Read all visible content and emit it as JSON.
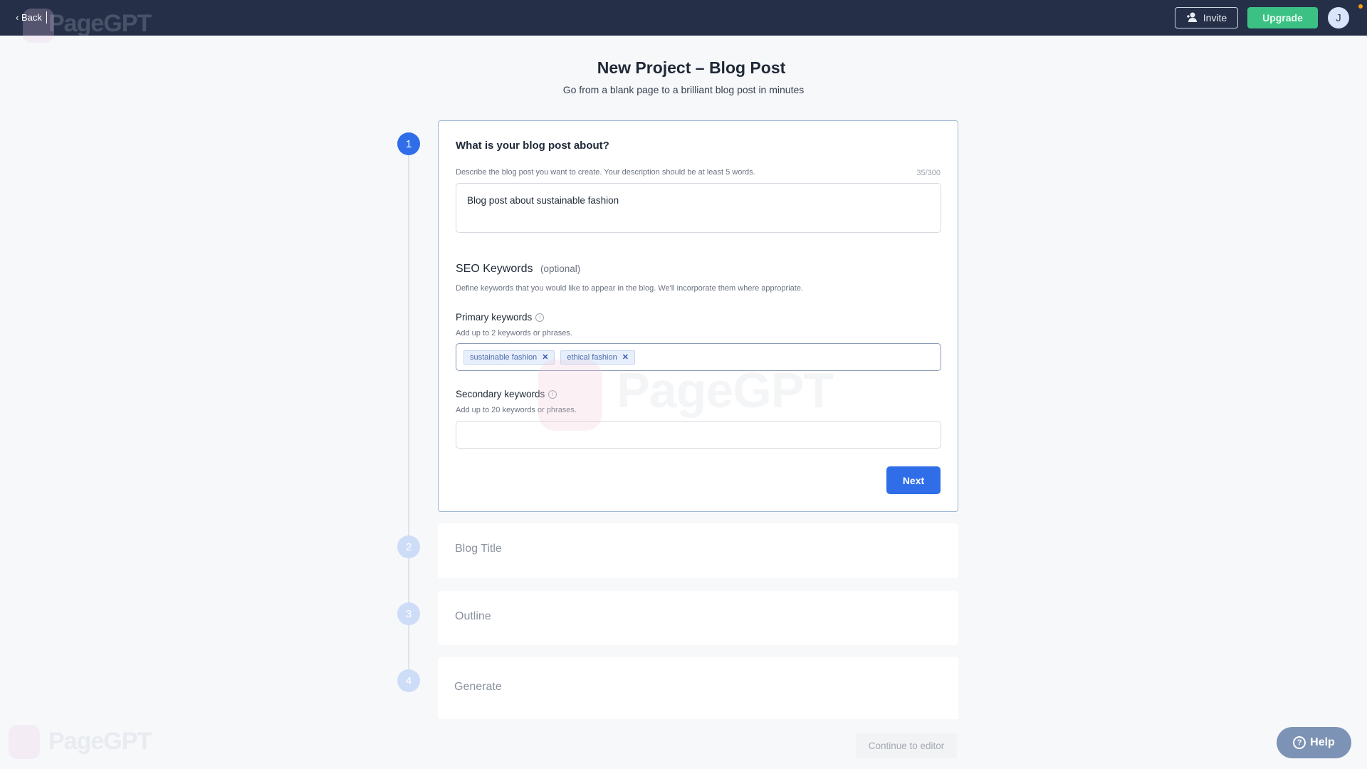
{
  "nav": {
    "back_label": "Back",
    "invite_label": "Invite",
    "upgrade_label": "Upgrade",
    "avatar_initial": "J",
    "watermark": "PageGPT"
  },
  "header": {
    "title": "New Project – Blog Post",
    "subtitle": "Go from a blank page to a brilliant blog post in minutes"
  },
  "steps": [
    {
      "number": "1",
      "label": "What is your blog post about?",
      "state": "active"
    },
    {
      "number": "2",
      "label": "Blog Title",
      "state": "inactive"
    },
    {
      "number": "3",
      "label": "Outline",
      "state": "inactive"
    },
    {
      "number": "4",
      "label": "Generate",
      "state": "inactive"
    }
  ],
  "step1": {
    "description_help": "Describe the blog post you want to create. Your description should be at least 5 words.",
    "char_count": "35/300",
    "description_value": "Blog post about sustainable fashion",
    "seo_title": "SEO Keywords",
    "seo_optional": "(optional)",
    "seo_help": "Define keywords that you would like to appear in the blog. We'll incorporate them where appropriate.",
    "primary_label": "Primary keywords",
    "primary_help": "Add up to 2 keywords or phrases.",
    "primary_keywords": [
      "sustainable fashion",
      "ethical fashion"
    ],
    "secondary_label": "Secondary keywords",
    "secondary_help": "Add up to 20 keywords or phrases.",
    "secondary_value": "",
    "next_label": "Next"
  },
  "footer": {
    "continue_label": "Continue to editor",
    "help_label": "Help"
  },
  "colors": {
    "nav": "#252f47",
    "accent": "#2f6ee8",
    "upgrade": "#3cc184",
    "help": "#7d93b5"
  }
}
